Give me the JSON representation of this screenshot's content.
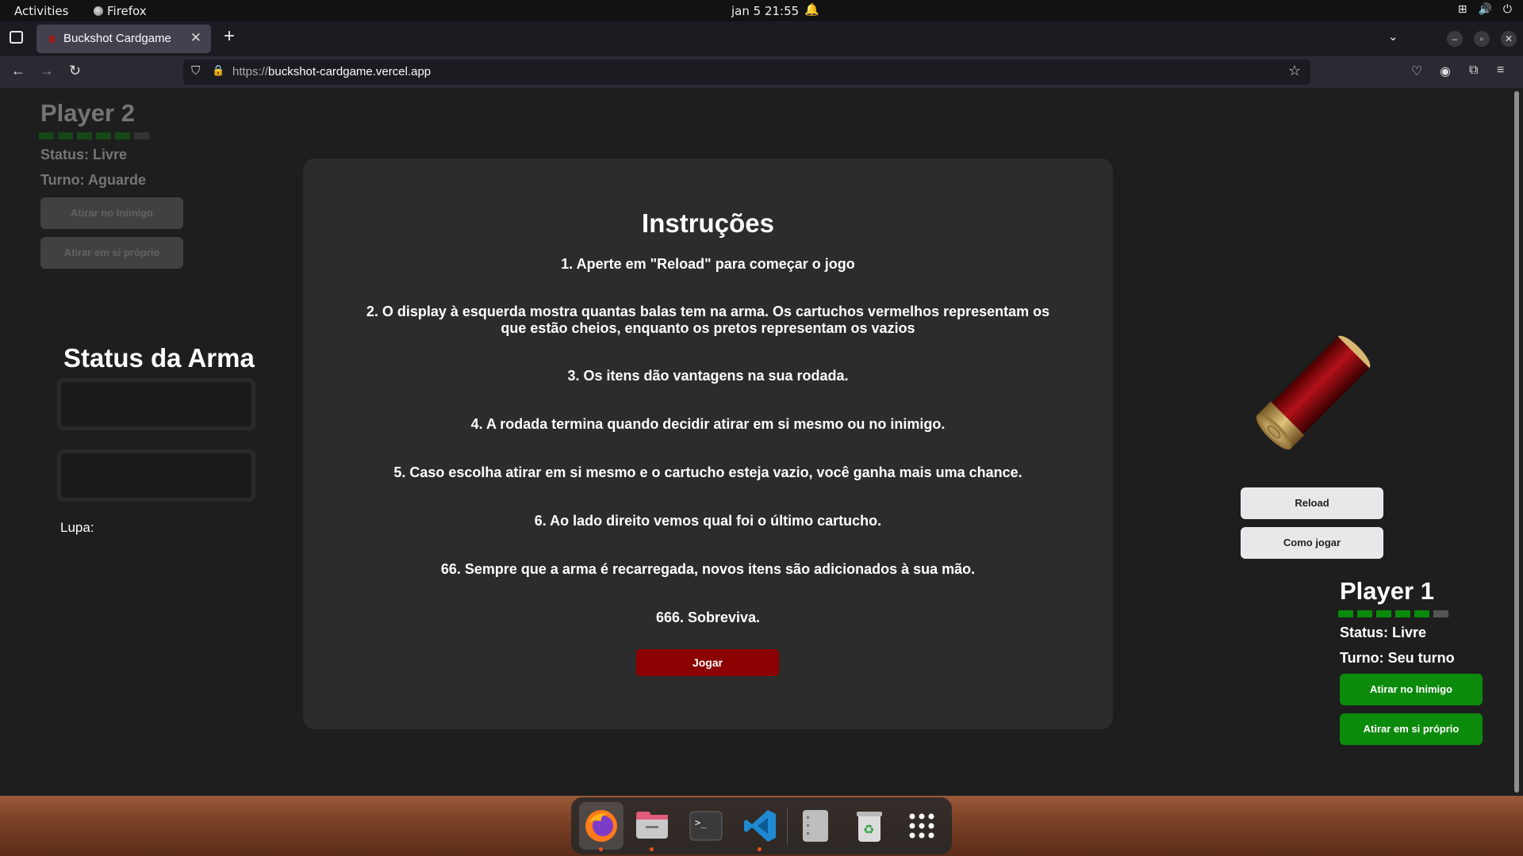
{
  "topbar": {
    "activities": "Activities",
    "app_name": "Firefox",
    "clock": "jan 5  21:55"
  },
  "browser": {
    "tab_title": "Buckshot Cardgame",
    "url_protocol": "https://",
    "url_host": "buckshot-cardgame.vercel.app"
  },
  "player2": {
    "name": "Player 2",
    "status": "Status: Livre",
    "turn": "Turno: Aguarde",
    "hp_filled": 5,
    "hp_total": 6,
    "shoot_enemy": "Atirar no Inimigo",
    "shoot_self": "Atirar em si próprio"
  },
  "weapon": {
    "title": "Status da Arma",
    "lupa_label": "Lupa:"
  },
  "modal": {
    "title": "Instruções",
    "steps": [
      "1. Aperte em \"Reload\" para começar o jogo",
      "2. O display à esquerda mostra quantas balas tem na arma. Os cartuchos vermelhos representam os que estão cheios, enquanto os pretos representam os vazios",
      "3. Os itens dão vantagens na sua rodada.",
      "4. A rodada termina quando decidir atirar em si mesmo ou no inimigo.",
      "5. Caso escolha atirar em si mesmo e o cartucho esteja vazio, você ganha mais uma chance.",
      "6. Ao lado direito vemos qual foi o último cartucho.",
      "66. Sempre que a arma é recarregada, novos itens são adicionados à sua mão.",
      "666. Sobreviva."
    ],
    "play_button": "Jogar"
  },
  "side": {
    "reload": "Reload",
    "how_to_play": "Como jogar"
  },
  "player1": {
    "name": "Player 1",
    "status": "Status: Livre",
    "turn": "Turno: Seu turno",
    "hp_filled": 5,
    "hp_total": 6,
    "shoot_enemy": "Atirar no Inimigo",
    "shoot_self": "Atirar em si próprio"
  },
  "colors": {
    "health": "#0a8a0a",
    "action_green": "#0c8a0c",
    "play_red": "#8b0000",
    "modal_bg": "#2c2c2c"
  },
  "dock": {
    "apps": [
      "firefox-icon",
      "files-icon",
      "terminal-icon",
      "vscode-icon",
      "text-editor-icon",
      "trash-icon",
      "app-grid-icon"
    ]
  }
}
